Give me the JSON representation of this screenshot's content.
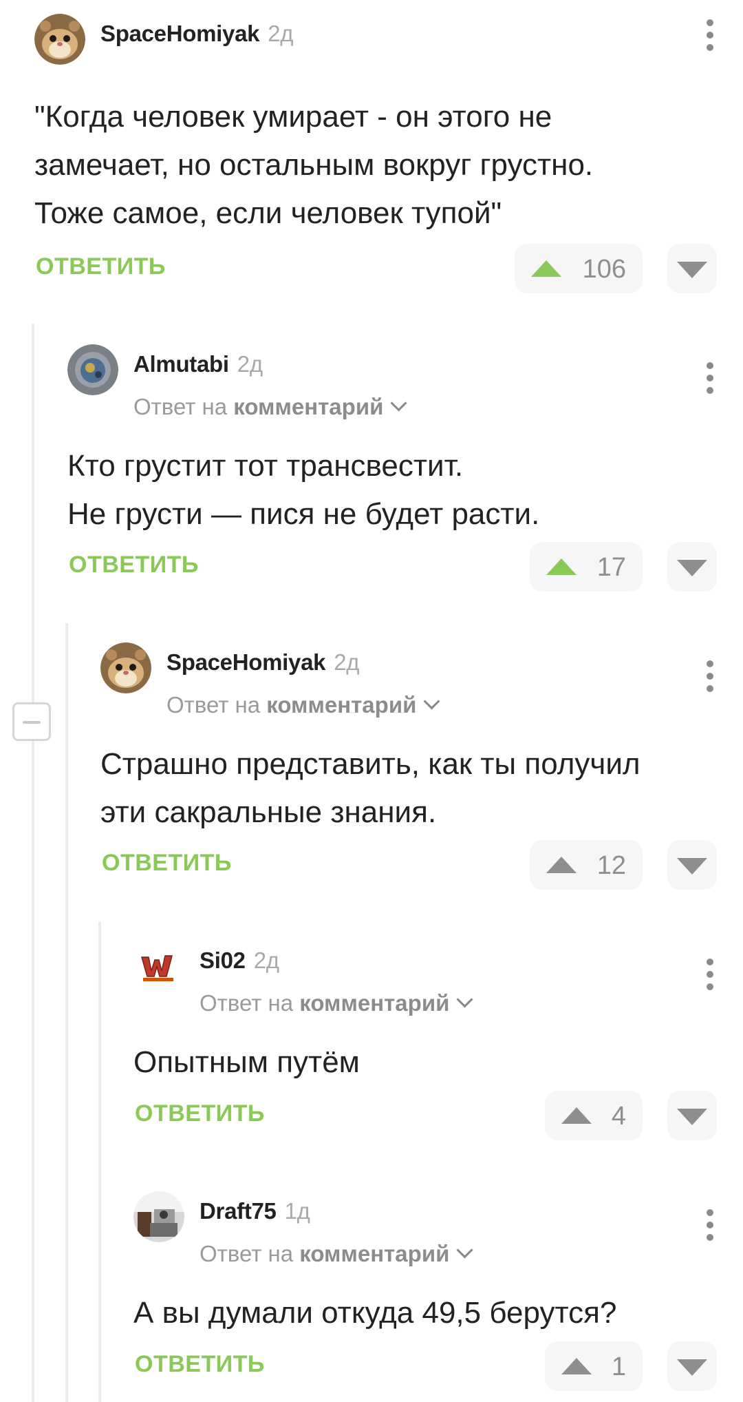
{
  "comments": [
    {
      "author": "SpaceHomiyak",
      "time": "2д",
      "reply_prefix": "",
      "reply_target": "",
      "text": "\"Когда человек умирает - он этого не\nзамечает, но остальным вокруг грустно.\nТоже самое, если человек тупой\"",
      "reply_label": "ОТВЕТИТЬ",
      "votes": "106",
      "upvoted": true,
      "avatar_icon": "hamster-avatar-icon"
    },
    {
      "author": "Almutabi",
      "time": "2д",
      "reply_prefix": "Ответ на",
      "reply_target": "комментарий",
      "text": "Кто грустит тот трансвестит.\nНе грусти — пися не будет расти.",
      "reply_label": "ОТВЕТИТЬ",
      "votes": "17",
      "upvoted": true,
      "avatar_icon": "moon-crater-avatar-icon"
    },
    {
      "author": "SpaceHomiyak",
      "time": "2д",
      "reply_prefix": "Ответ на",
      "reply_target": "комментарий",
      "text": "Страшно представить, как ты получил\nэти сакральные знания.",
      "reply_label": "ОТВЕТИТЬ",
      "votes": "12",
      "upvoted": false,
      "avatar_icon": "hamster-avatar-icon"
    },
    {
      "author": "Si02",
      "time": "2д",
      "reply_prefix": "Ответ на",
      "reply_target": "комментарий",
      "text": "Опытным путём",
      "reply_label": "ОТВЕТИТЬ",
      "votes": "4",
      "upvoted": false,
      "avatar_icon": "logo-avatar-icon"
    },
    {
      "author": "Draft75",
      "time": "1д",
      "reply_prefix": "Ответ на",
      "reply_target": "комментарий",
      "text": "А вы думали откуда 49,5 берутся?",
      "reply_label": "ОТВЕТИТЬ",
      "votes": "1",
      "upvoted": false,
      "avatar_icon": "photo-avatar-icon"
    }
  ],
  "colors": {
    "accent_green": "#8ac858",
    "muted_gray": "#8e8e8e",
    "vote_bg": "#f6f6f6"
  }
}
